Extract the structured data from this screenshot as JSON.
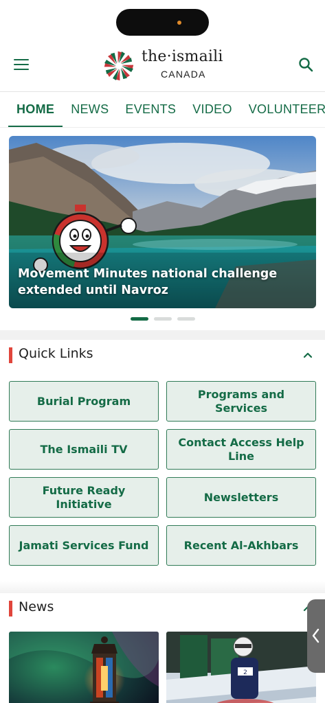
{
  "header": {
    "logo_text": "the·ismaili",
    "logo_sub": "CANADA"
  },
  "tabs": [
    {
      "label": "HOME",
      "active": true
    },
    {
      "label": "NEWS",
      "active": false
    },
    {
      "label": "EVENTS",
      "active": false
    },
    {
      "label": "VIDEO",
      "active": false
    },
    {
      "label": "VOLUNTEER",
      "active": false
    }
  ],
  "hero": {
    "title": "Movement Minutes national challenge extended until Navroz",
    "slides": 3,
    "active_slide": 0
  },
  "quick_links": {
    "title": "Quick Links",
    "items": [
      "Burial Program",
      "Programs and Services",
      "The Ismaili TV",
      "Contact Access Help Line",
      "Future Ready Initiative",
      "Newsletters",
      "Jamati Services Fund",
      "Recent Al-Akhbars"
    ]
  },
  "news": {
    "title": "News"
  },
  "icons": {
    "menu": "hamburger-menu-icon",
    "search": "search-icon",
    "collapse": "chevron-up-icon",
    "side_tab": "chevron-left-icon"
  },
  "colors": {
    "brand_green": "#146b46",
    "accent_red": "#e0453b",
    "tile_bg": "#e6efea"
  }
}
